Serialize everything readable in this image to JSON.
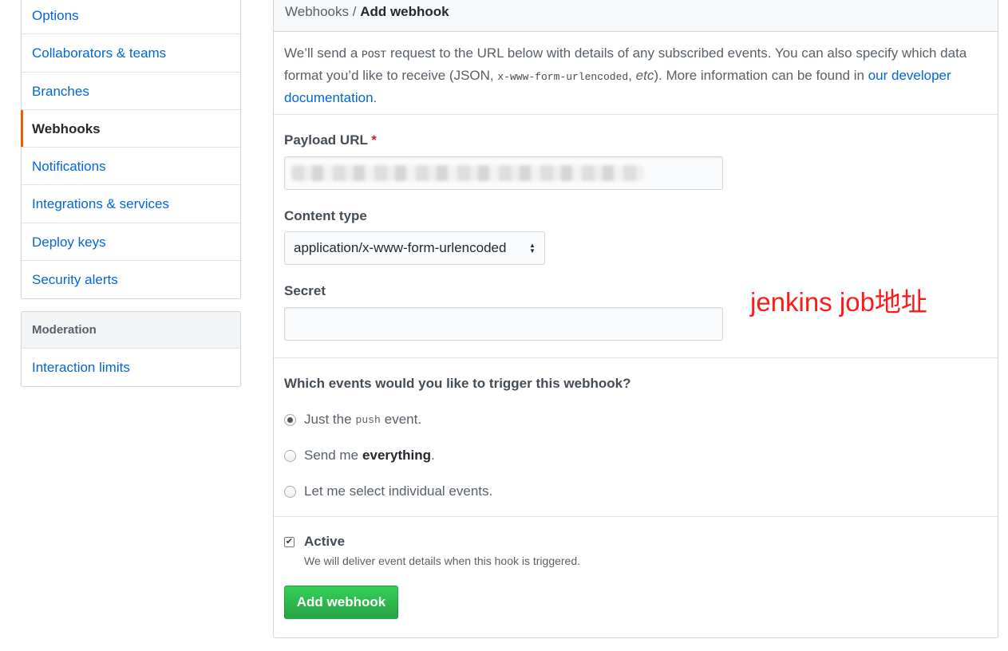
{
  "sidebar": {
    "items": [
      {
        "label": "Options"
      },
      {
        "label": "Collaborators & teams"
      },
      {
        "label": "Branches"
      },
      {
        "label": "Webhooks"
      },
      {
        "label": "Notifications"
      },
      {
        "label": "Integrations & services"
      },
      {
        "label": "Deploy keys"
      },
      {
        "label": "Security alerts"
      }
    ],
    "selected": "Webhooks",
    "moderation": {
      "heading": "Moderation",
      "items": [
        {
          "label": "Interaction limits"
        }
      ]
    }
  },
  "breadcrumb": {
    "parent": "Webhooks",
    "separator": " / ",
    "current": "Add webhook"
  },
  "intro": {
    "part1": "We’ll send a ",
    "method": "POST",
    "part2": " request to the URL below with details of any subscribed events. You can also specify which data format you’d like to receive (JSON, ",
    "format_code": "x-www-form-urlencoded",
    "part3": ", ",
    "etc": "etc",
    "part4": "). More information can be found in ",
    "link": "our developer documentation",
    "part5": "."
  },
  "form": {
    "payload_label": "Payload URL",
    "required_mark": "*",
    "payload_value": "",
    "content_type_label": "Content type",
    "content_type_value": "application/x-www-form-urlencoded",
    "secret_label": "Secret",
    "secret_value": ""
  },
  "annotation": {
    "text": "jenkins  job地址",
    "color": "#ff1a1a"
  },
  "events": {
    "question": "Which events would you like to trigger this webhook?",
    "option1": {
      "pre": "Just the",
      "code": "push",
      "post": "event.",
      "checked": true
    },
    "option2": {
      "pre": "Send me",
      "bold": "everything",
      "post": ".",
      "checked": false
    },
    "option3": {
      "label": "Let me select individual events.",
      "checked": false
    }
  },
  "active": {
    "label": "Active",
    "note": "We will deliver event details when this hook is triggered.",
    "checked": true
  },
  "submit_label": "Add webhook",
  "colors": {
    "link": "#0366d6",
    "selected_accent": "#e36209",
    "button": "#28a745",
    "annotation": "#ff1a1a"
  }
}
